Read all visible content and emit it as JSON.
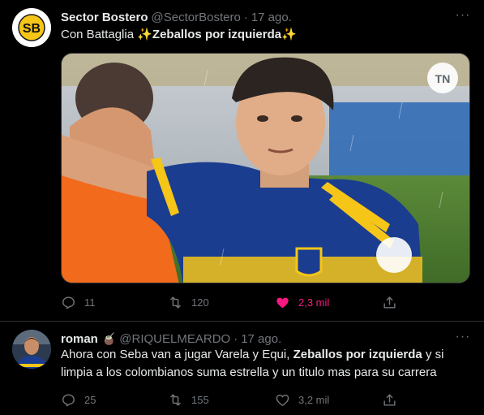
{
  "tweets": [
    {
      "avatar_text": "SB",
      "name": "Sector Bostero",
      "handle": "@SectorBostero",
      "separator": "·",
      "date": "17 ago.",
      "more": "···",
      "text_plain": "Con Battaglia ",
      "sparkle_left": "✨",
      "text_bold": "Zeballos por izquierda",
      "sparkle_right": "✨",
      "media_description_badge": "TN",
      "actions": {
        "replies": "11",
        "retweets": "120",
        "likes": "2,3 mil"
      },
      "liked": true
    },
    {
      "name": "roman",
      "name_emoji": "🧉",
      "handle": "@RIQUELMEARDO",
      "separator": "·",
      "date": "17 ago.",
      "more": "···",
      "text_part1": "Ahora con Seba van a jugar Varela y Equi, ",
      "text_bold": "Zeballos por izquierda",
      "text_part2": " y si limpia a los colombianos suma estrella y un titulo mas para su carrera",
      "actions": {
        "replies": "25",
        "retweets": "155",
        "likes": "3,2 mil"
      },
      "liked": false
    }
  ],
  "colors": {
    "background": "#000000",
    "text": "#e7e9ea",
    "muted": "#71767b",
    "like": "#f91880",
    "divider": "#2f3336",
    "boca_blue": "#1b3d8f",
    "boca_yellow": "#f5c518"
  },
  "icons": [
    "sector-bostero-logo",
    "reply-icon",
    "retweet-icon",
    "like-icon",
    "share-icon",
    "more-icon"
  ]
}
